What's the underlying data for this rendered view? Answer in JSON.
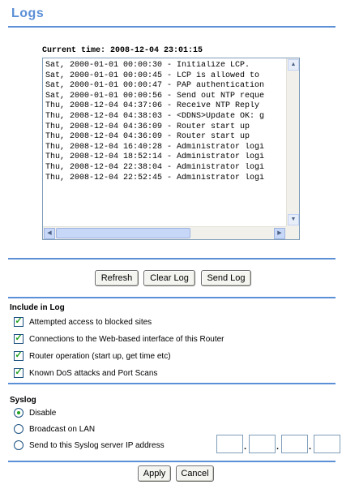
{
  "page": {
    "title": "Logs"
  },
  "current_time": {
    "text": "Current time: 2008-12-04 23:01:15"
  },
  "log": {
    "lines": [
      "Sat, 2000-01-01 00:00:30 - Initialize LCP.",
      "Sat, 2000-01-01 00:00:45 - LCP is allowed to",
      "Sat, 2000-01-01 00:00:47 - PAP authentication",
      "Sat, 2000-01-01 00:00:56 - Send out NTP reque",
      "Thu, 2008-12-04 04:37:06 - Receive NTP Reply",
      "Thu, 2008-12-04 04:38:03 - <DDNS>Update OK: g",
      "Thu, 2008-12-04 04:36:09 - Router start up",
      "Thu, 2008-12-04 04:36:09 - Router start up",
      "Thu, 2008-12-04 16:40:28 - Administrator logi",
      "Thu, 2008-12-04 18:52:14 - Administrator logi",
      "Thu, 2008-12-04 22:38:04 - Administrator logi",
      "Thu, 2008-12-04 22:52:45 - Administrator logi"
    ]
  },
  "buttons": {
    "refresh": "Refresh",
    "clear_log": "Clear Log",
    "send_log": "Send Log",
    "apply": "Apply",
    "cancel": "Cancel"
  },
  "include": {
    "title": "Include in Log",
    "items": [
      {
        "label": "Attempted access to blocked sites",
        "checked": true
      },
      {
        "label": "Connections to the Web-based interface of this Router",
        "checked": true
      },
      {
        "label": "Router operation (start up, get time etc)",
        "checked": true
      },
      {
        "label": "Known DoS attacks and Port Scans",
        "checked": true
      }
    ]
  },
  "syslog": {
    "title": "Syslog",
    "options": [
      {
        "label": "Disable",
        "selected": true
      },
      {
        "label": "Broadcast on LAN",
        "selected": false
      },
      {
        "label": "Send to this Syslog server IP address",
        "selected": false
      }
    ],
    "ip": [
      "",
      "",
      "",
      ""
    ]
  },
  "colors": {
    "accent": "#5b8fd6",
    "check": "#21a121"
  },
  "icons": {
    "check": "check-icon",
    "radio": "radio-dot-icon",
    "scroll_up": "up-arrow-icon",
    "scroll_down": "down-arrow-icon",
    "scroll_left": "left-arrow-icon",
    "scroll_right": "right-arrow-icon"
  }
}
